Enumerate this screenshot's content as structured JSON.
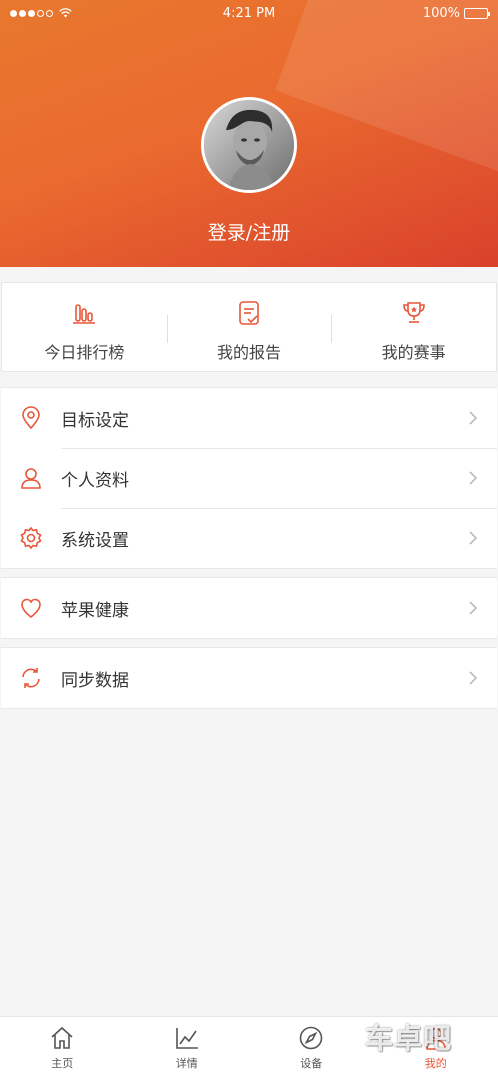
{
  "status_bar": {
    "time": "4:21 PM",
    "battery": "100%",
    "signal_level": 3,
    "signal_max": 5
  },
  "profile": {
    "login_label": "登录/注册"
  },
  "quick_actions": [
    {
      "label": "今日排行榜",
      "icon": "bar-chart-icon"
    },
    {
      "label": "我的报告",
      "icon": "report-icon"
    },
    {
      "label": "我的赛事",
      "icon": "trophy-icon"
    }
  ],
  "menu_groups": [
    [
      {
        "label": "目标设定",
        "icon": "location-pin-icon"
      },
      {
        "label": "个人资料",
        "icon": "person-icon"
      },
      {
        "label": "系统设置",
        "icon": "gear-icon"
      }
    ],
    [
      {
        "label": "苹果健康",
        "icon": "heart-icon"
      }
    ],
    [
      {
        "label": "同步数据",
        "icon": "sync-icon"
      }
    ]
  ],
  "tabbar": {
    "items": [
      {
        "label": "主页",
        "icon": "home-icon",
        "active": false
      },
      {
        "label": "详情",
        "icon": "line-chart-icon",
        "active": false
      },
      {
        "label": "设备",
        "icon": "compass-icon",
        "active": false
      },
      {
        "label": "我的",
        "icon": "person-icon",
        "active": true
      }
    ]
  },
  "watermark": "车卓吧",
  "colors": {
    "accent": "#e8573a",
    "header_start": "#e8782e",
    "header_end": "#d9412b",
    "background": "#f5f5f5"
  }
}
